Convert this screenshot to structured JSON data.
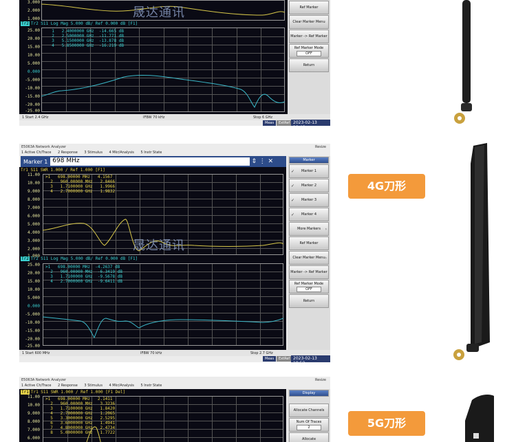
{
  "watermark": "晟达通讯",
  "panel1": {
    "top_axis": [
      "3.000",
      "2.000",
      "1.000"
    ],
    "s11_header": "Tr2  S11  Log Mag 5.000 dB/ Ref 0.000 dB  [F1]",
    "markers": "  1   2.4000000 GHz  -14.665 dB\n  2   2.5000000 GHz  -11.771 dB\n  3   5.1500000 GHz  -13.878 dB\n  4   5.8500000 GHz  -16.219 dB",
    "yaxis": [
      "25.00",
      "20.00",
      "15.00",
      "10.00",
      "5.000",
      "0.000",
      "-5.000",
      "-10.00",
      "-15.00",
      "-20.00",
      "-25.00"
    ],
    "start": "1  Start 2.4 GHz",
    "ifbw": "IFBW 70 kHz",
    "stop": "Stop 6 GHz",
    "meas": "Meas",
    "extref": "ExtRef",
    "timestamp": "2023-02-13 18:46",
    "softkeys": [
      "Ref Marker",
      "Clear Marker Menu",
      "Marker -> Ref Marker",
      "Ref Marker Mode",
      "Return"
    ],
    "ref_mode_value": "OFF"
  },
  "panel2": {
    "title": "E5063A Network Analyzer",
    "resize": "Resize",
    "menu": [
      "1 Active Ch/Trace",
      "2 Response",
      "3 Stimulus",
      "4 Mkr/Analysis",
      "5 Instr State"
    ],
    "marker_label": "Marker 1",
    "marker_value": "698 MHz",
    "tr1_header": "Tr1  S11  SWR 1.000 / Ref 1.000  [F1]",
    "tr1_markers": ">1   698.00000 MHz   4.1567\n  2   960.00000 MHz   2.8466\n  3   1.7100000 GHz   1.9966\n  4   2.7000000 GHz   1.9832",
    "tr1_yaxis": [
      "11.00",
      "10.00",
      "9.000",
      "8.000",
      "7.000",
      "6.000",
      "5.000",
      "4.000",
      "3.000",
      "2.000",
      "1.000"
    ],
    "tr2_header": "Tr2  S11  Log Mag 5.000 dB/ Ref 0.000 dB  [F1]",
    "tr2_markers": ">1   698.00000 MHz  -4.2637 dB\n  2   960.00000 MHz  -6.3419 dB\n  3   1.7100000 GHz  -9.5678 dB\n  4   2.7000000 GHz  -9.6411 dB",
    "tr2_yaxis": [
      "25.00",
      "20.00",
      "15.00",
      "10.00",
      "5.000",
      "0.000",
      "-5.000",
      "-10.00",
      "-15.00",
      "-20.00",
      "-25.00"
    ],
    "start": "1  Start 600 MHz",
    "ifbw": "IFBW 70 kHz",
    "stop": "Stop 2.7 GHz",
    "meas": "Meas",
    "extref": "ExtRef",
    "timestamp": "2023-02-13 18:52",
    "softkeys": [
      "Marker",
      "Marker 1",
      "Marker 2",
      "Marker 3",
      "Marker 4",
      "More Markers",
      "Ref Marker",
      "Clear Marker Menu",
      "Marker -> Ref Marker",
      "Ref Marker Mode",
      "Return"
    ],
    "ref_mode_value": "OFF"
  },
  "panel3": {
    "title": "E5063A Network Analyzer",
    "resize": "Resize",
    "menu": [
      "1 Active Ch/Trace",
      "2 Response",
      "3 Stimulus",
      "4 Mkr/Analysis",
      "5 Instr State"
    ],
    "tr1_header": "Tr1  S11  SWR 1.000 / Ref 1.000  [F1 Del]",
    "tr1_markers": ">1   698.00000 MHz   2.1411\n  2   960.00000 MHz   3.3236\n  3   1.7100000 GHz   1.8420\n  4   2.7000000 GHz   1.2065\n  5   3.3000000 GHz   2.5295\n  6   3.6000000 GHz   1.4941\n  7   4.8000000 GHz   2.4734\n  8   5.0000000 GHz   1.7722",
    "tr1_yaxis": [
      "11.00",
      "10.00",
      "9.000",
      "8.000",
      "7.000",
      "6.000"
    ],
    "softkeys": [
      "Display",
      "Allocate Channels",
      "Num Of Traces",
      "Allocate"
    ],
    "num_traces_value": "2"
  },
  "badges": {
    "b4g": "4G刀形",
    "b5g": "5G刀形"
  }
}
